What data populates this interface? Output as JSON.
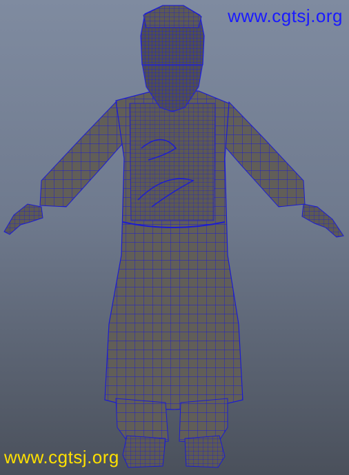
{
  "watermark_top": {
    "text": "www.cgtsj.org",
    "color": "#1a1aff"
  },
  "watermark_bottom": {
    "text": "www.cgtsj.org",
    "color": "#ffe000"
  },
  "model": {
    "wire_color": "#1a1ad6",
    "surface_color": "#5f5c57",
    "surface_light": "#7a7770"
  }
}
